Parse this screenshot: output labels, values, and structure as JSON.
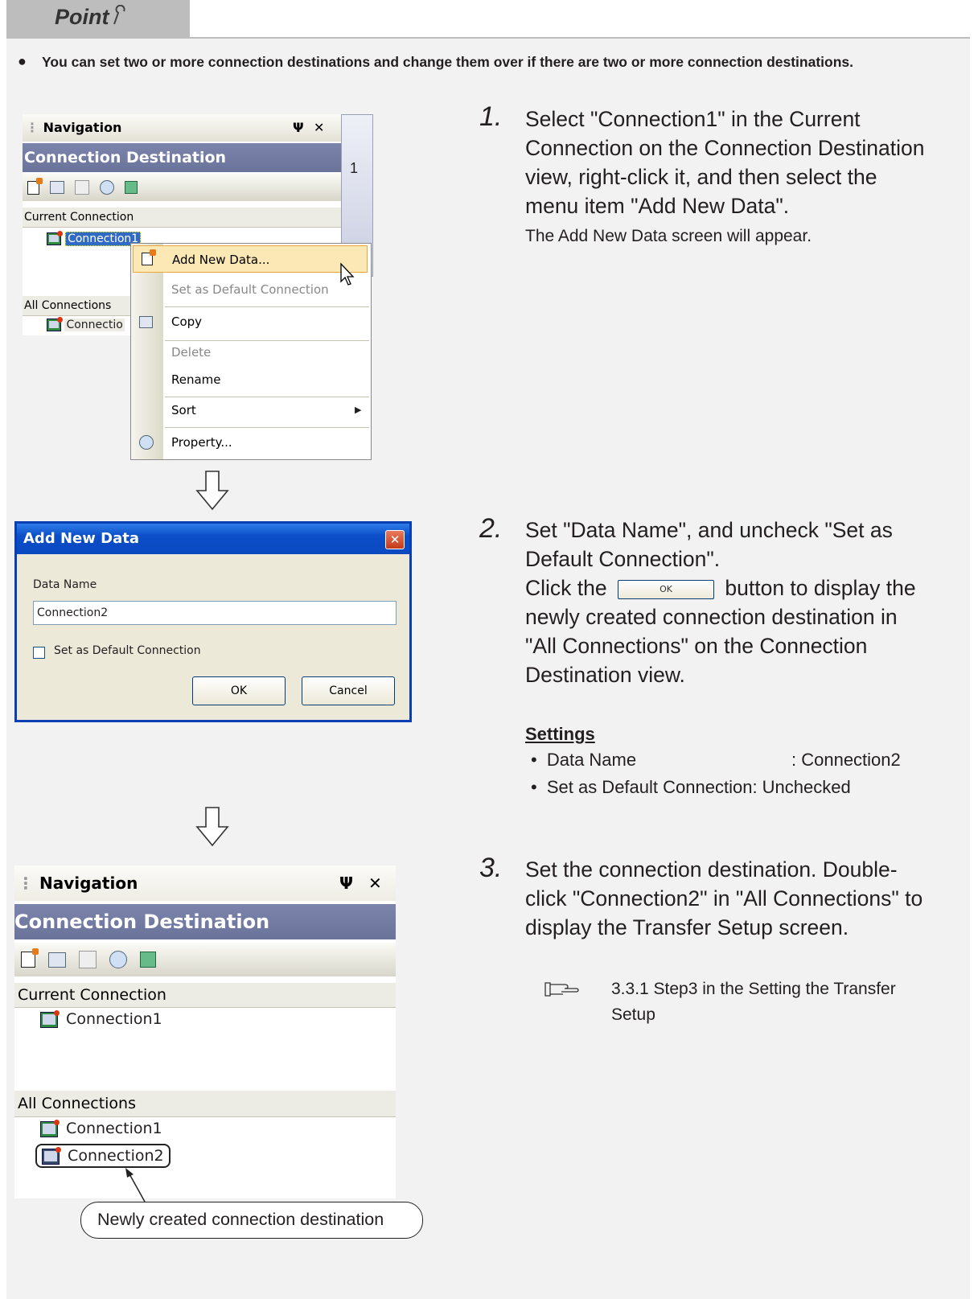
{
  "point": {
    "label": "Point"
  },
  "intro": {
    "bullet": "●",
    "text": "You can set two or more connection destinations and change them over if there are two or more connection destinations."
  },
  "nav_top": {
    "title": "Navigation",
    "pin": "Ψ",
    "close": "✕",
    "header": "Connection Destination",
    "current_section": "Current Connection",
    "current_item": "Connection1",
    "all_section": "All Connections",
    "all_item": "Connectio",
    "side_number": "1"
  },
  "context_menu": {
    "items": [
      {
        "label": "Add New Data...",
        "hotkey": "A",
        "disabled": false
      },
      {
        "label": "Set as Default Connection",
        "disabled": true
      },
      {
        "label": "Copy",
        "disabled": false
      },
      {
        "label": "Delete",
        "disabled": true
      },
      {
        "label": "Rename",
        "disabled": false
      },
      {
        "label": "Sort",
        "disabled": false,
        "submenu": true
      },
      {
        "label": "Property...",
        "disabled": false
      }
    ]
  },
  "dialog": {
    "title": "Add New Data",
    "data_name_label": "Data Name",
    "data_name_value": "Connection2",
    "default_checkbox_label": "Set as Default Connection",
    "default_checked": false,
    "ok": "OK",
    "cancel": "Cancel"
  },
  "nav_bottom": {
    "title": "Navigation",
    "pin": "Ψ",
    "close": "✕",
    "header": "Connection Destination",
    "current_section": "Current Connection",
    "current_item": "Connection1",
    "all_section": "All Connections",
    "all_items": [
      "Connection1",
      "Connection2"
    ],
    "callout": "Newly created connection destination"
  },
  "steps": [
    {
      "num": "1.",
      "text": "Select \"Connection1\" in the Current Connection on the Connection Destination view, right-click it, and then select the menu item \"Add New Data\".",
      "note": "The Add New Data screen will appear."
    },
    {
      "num": "2.",
      "text_a": "Set \"Data Name\", and uncheck \"Set as Default Connection\".",
      "text_b_pre": "Click  the",
      "inline_button": "OK",
      "text_b_post": "button to display the newly created connection destination in \"All Connections\" on the Connection Destination view.",
      "settings_title": "Settings",
      "settings": [
        {
          "bullet": "•",
          "label": "Data Name",
          "value": ": Connection2"
        },
        {
          "bullet": "•",
          "label": "Set as Default Connection",
          "value": ": Unchecked"
        }
      ]
    },
    {
      "num": "3.",
      "text": "Set the connection destination. Double-click \"Connection2\" in \"All Connections\" to display the Transfer Setup screen.",
      "ref_icon": "pointing-hand-icon",
      "ref_text": "3.3.1 Step3 in the Setting the Transfer Setup"
    }
  ]
}
